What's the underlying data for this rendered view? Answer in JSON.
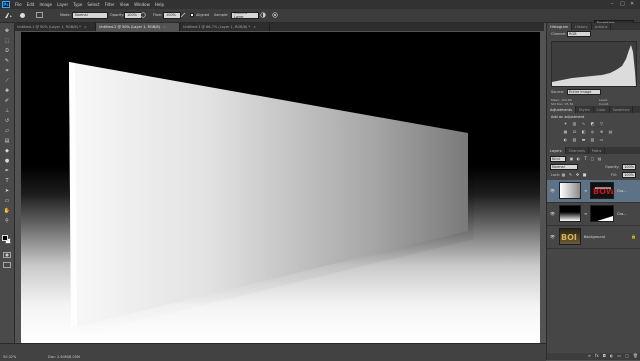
{
  "app": {
    "logo": "Ps"
  },
  "menu": [
    "File",
    "Edit",
    "Image",
    "Layer",
    "Type",
    "Select",
    "Filter",
    "View",
    "Window",
    "Help"
  ],
  "window_controls": {
    "minimize": "–",
    "maximize": "□",
    "close": "✕"
  },
  "options": {
    "mode_label": "Mode:",
    "mode_value": "Normal",
    "opacity_label": "Opacity:",
    "opacity_value": "100%",
    "flow_label": "Flow:",
    "flow_value": "100%",
    "aligned_label": "Aligned",
    "sample_label": "Sample:",
    "sample_value": "Current Layer",
    "workspace": "Essentials"
  },
  "tabs": [
    {
      "label": "Untitled-1 @ 50% (Layer 1, RGB/8) *",
      "active": false
    },
    {
      "label": "Untitled-2 @ 50% (Layer 1, RGB/8)",
      "active": true
    },
    {
      "label": "Untitled-3 @ 66.7% (Layer 1, RGB/8) *",
      "active": false
    }
  ],
  "status": {
    "zoom": "50.02%",
    "doc": "Doc: 2.64M/8.00M"
  },
  "histogram": {
    "tabs": [
      "Histogram",
      "History",
      "Actions"
    ],
    "channel_label": "Channel:",
    "channel_value": "RGB",
    "source_label": "Source:",
    "source_value": "Entire Image",
    "stats_left": [
      "Mean: 102.89",
      "Std Dev: 95.36",
      "Median: 107",
      "Pixels: 247456"
    ],
    "stats_right": [
      "Level:",
      "Count:",
      "Percentile:",
      "Cache Level: 1"
    ]
  },
  "adjustments": {
    "tabs": [
      "Adjustments",
      "Styles",
      "Color",
      "Swatches"
    ],
    "title": "Add an adjustment"
  },
  "layers": {
    "tabs": [
      "Layers",
      "Channels",
      "Paths"
    ],
    "kind_label": "Kind",
    "blend_value": "Normal",
    "opacity_label": "Opacity:",
    "opacity_value": "100%",
    "lock_label": "Lock:",
    "fill_label": "Fill:",
    "fill_value": "100%",
    "items": [
      {
        "name": "Gra..."
      },
      {
        "name": "Gra..."
      },
      {
        "name": "Background"
      }
    ]
  },
  "icons": {
    "tools": [
      "move-icon",
      "marquee-icon",
      "lasso-icon",
      "quick-select-icon",
      "crop-icon",
      "eyedropper-icon",
      "healing-icon",
      "brush-icon",
      "clone-stamp-icon",
      "history-brush-icon",
      "eraser-icon",
      "gradient-icon",
      "blur-icon",
      "dodge-icon",
      "pen-icon",
      "type-icon",
      "path-select-icon",
      "shape-icon",
      "hand-icon",
      "zoom-icon"
    ]
  }
}
